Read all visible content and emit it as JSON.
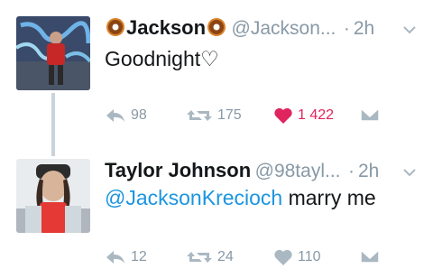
{
  "tweets": [
    {
      "display_name": "Jackson",
      "name_emoji": "donut-emoji",
      "handle": "@Jackson...",
      "separator": "·",
      "time": "2h",
      "text": "Goodnight♡",
      "actions": {
        "reply_count": "98",
        "retweet_count": "175",
        "like_count": "1 422",
        "liked": true
      }
    },
    {
      "display_name": "Taylor Johnson",
      "handle": "@98tayl...",
      "separator": "·",
      "time": "2h",
      "mention": "@JacksonKrecioch",
      "text": " marry me",
      "actions": {
        "reply_count": "12",
        "retweet_count": "24",
        "like_count": "110",
        "liked": false
      }
    }
  ],
  "colors": {
    "text": "#14171a",
    "muted": "#8899a6",
    "link": "#1b95e0",
    "like_active": "#e0245e"
  }
}
